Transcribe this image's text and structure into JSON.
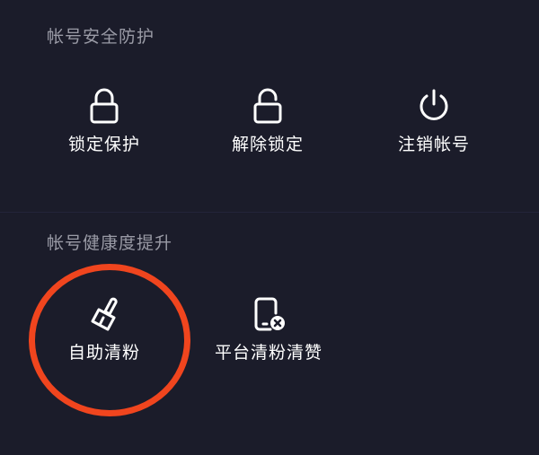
{
  "security": {
    "title": "帐号安全防护",
    "items": [
      {
        "label": "锁定保护",
        "icon": "lock-icon"
      },
      {
        "label": "解除锁定",
        "icon": "unlock-icon"
      },
      {
        "label": "注销帐号",
        "icon": "power-icon"
      }
    ]
  },
  "health": {
    "title": "帐号健康度提升",
    "items": [
      {
        "label": "自助清粉",
        "icon": "brush-icon"
      },
      {
        "label": "平台清粉清赞",
        "icon": "phone-remove-icon"
      }
    ]
  },
  "colors": {
    "background": "#1b1c2a",
    "section_title": "#9a9ba6",
    "text": "#ffffff",
    "highlight_annotation": "#f0451e"
  }
}
